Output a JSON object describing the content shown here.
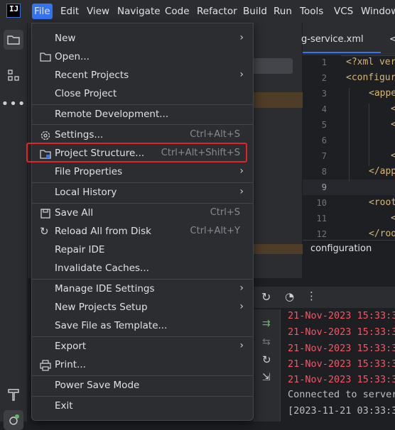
{
  "menubar": {
    "logo_text": "IJ",
    "items": [
      "File",
      "Edit",
      "View",
      "Navigate",
      "Code",
      "Refactor",
      "Build",
      "Run",
      "Tools",
      "VCS",
      "Window"
    ]
  },
  "editor": {
    "tab_label": "g-service.xml",
    "tab2_fragment": "<",
    "line_numbers": [
      "1",
      "2",
      "3",
      "4",
      "5",
      "6",
      "7",
      "8",
      "9",
      "10",
      "11",
      "12"
    ],
    "code_lines": [
      "<?xml ver",
      "<configur",
      "<appe",
      "<",
      "<",
      "",
      "<",
      "</app",
      "",
      "<root",
      "<",
      "</roo"
    ],
    "breadcrumb": "configuration"
  },
  "file_menu": {
    "items": [
      {
        "label": "New",
        "submenu": true
      },
      {
        "label": "Open...",
        "icon": "folder-icon"
      },
      {
        "label": "Recent Projects",
        "submenu": true
      },
      {
        "label": "Close Project"
      },
      {
        "label": "Remote Development..."
      },
      {
        "label": "Settings...",
        "shortcut": "Ctrl+Alt+S",
        "icon": "gear-icon"
      },
      {
        "label": "Project Structure...",
        "shortcut": "Ctrl+Alt+Shift+S",
        "icon": "project-structure-icon"
      },
      {
        "label": "File Properties",
        "submenu": true
      },
      {
        "label": "Local History",
        "submenu": true
      },
      {
        "label": "Save All",
        "shortcut": "Ctrl+S",
        "icon": "save-icon"
      },
      {
        "label": "Reload All from Disk",
        "shortcut": "Ctrl+Alt+Y",
        "icon": "reload-icon"
      },
      {
        "label": "Repair IDE"
      },
      {
        "label": "Invalidate Caches..."
      },
      {
        "label": "Manage IDE Settings",
        "submenu": true
      },
      {
        "label": "New Projects Setup",
        "submenu": true
      },
      {
        "label": "Save File as Template..."
      },
      {
        "label": "Export",
        "submenu": true
      },
      {
        "label": "Print...",
        "icon": "print-icon"
      },
      {
        "label": "Power Save Mode"
      },
      {
        "label": "Exit"
      }
    ],
    "submenu_arrow": "›"
  },
  "console": {
    "lines": [
      {
        "text": "21-Nov-2023 15:33:3",
        "type": "err"
      },
      {
        "text": "21-Nov-2023 15:33:3",
        "type": "err"
      },
      {
        "text": "21-Nov-2023 15:33:3",
        "type": "err"
      },
      {
        "text": "21-Nov-2023 15:33:3",
        "type": "err"
      },
      {
        "text": "21-Nov-2023 15:33:3",
        "type": "err"
      },
      {
        "text": "Connected to server",
        "type": "ok"
      },
      {
        "text": "[2023-11-21 03:33:3",
        "type": "ok"
      }
    ]
  },
  "colors": {
    "accent": "#3574f0",
    "error_text": "#f75464",
    "highlight_border": "#e5222a"
  }
}
